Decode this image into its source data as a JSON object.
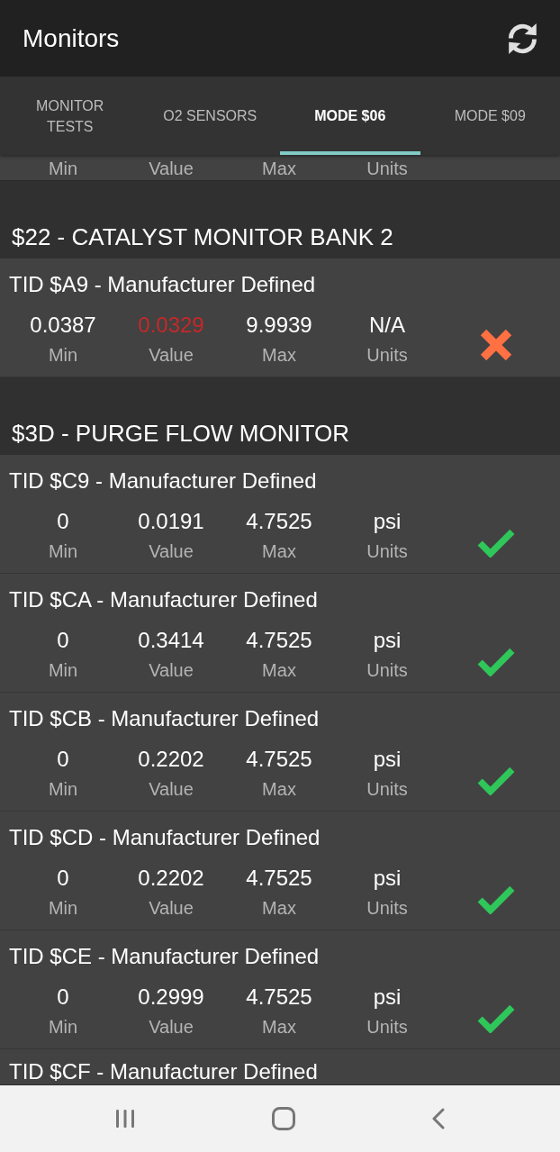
{
  "app_bar": {
    "title": "Monitors"
  },
  "tabs": [
    {
      "label": "MONITOR TESTS",
      "selected": false
    },
    {
      "label": "O2 SENSORS",
      "selected": false
    },
    {
      "label": "MODE $06",
      "selected": true
    },
    {
      "label": "MODE $09",
      "selected": false
    }
  ],
  "scrolled_row": {
    "labels": [
      "Min",
      "Value",
      "Max",
      "Units"
    ]
  },
  "sections": [
    {
      "title": "$22 - CATALYST MONITOR BANK 2",
      "tests": [
        {
          "title": "TID $A9 - Manufacturer Defined",
          "passed": false,
          "fields": [
            {
              "text": "0.0387",
              "label": "Min",
              "flagged": false
            },
            {
              "text": "0.0329",
              "label": "Value",
              "flagged": true
            },
            {
              "text": "9.9939",
              "label": "Max",
              "flagged": false
            },
            {
              "text": "N/A",
              "label": "Units",
              "flagged": false
            }
          ]
        }
      ]
    },
    {
      "title": "$3D - PURGE FLOW MONITOR",
      "tests": [
        {
          "title": "TID $C9 - Manufacturer Defined",
          "passed": true,
          "fields": [
            {
              "text": "0",
              "label": "Min",
              "flagged": false
            },
            {
              "text": "0.0191",
              "label": "Value",
              "flagged": false
            },
            {
              "text": "4.7525",
              "label": "Max",
              "flagged": false
            },
            {
              "text": "psi",
              "label": "Units",
              "flagged": false
            }
          ]
        },
        {
          "title": "TID $CA - Manufacturer Defined",
          "passed": true,
          "fields": [
            {
              "text": "0",
              "label": "Min",
              "flagged": false
            },
            {
              "text": "0.3414",
              "label": "Value",
              "flagged": false
            },
            {
              "text": "4.7525",
              "label": "Max",
              "flagged": false
            },
            {
              "text": "psi",
              "label": "Units",
              "flagged": false
            }
          ]
        },
        {
          "title": "TID $CB - Manufacturer Defined",
          "passed": true,
          "fields": [
            {
              "text": "0",
              "label": "Min",
              "flagged": false
            },
            {
              "text": "0.2202",
              "label": "Value",
              "flagged": false
            },
            {
              "text": "4.7525",
              "label": "Max",
              "flagged": false
            },
            {
              "text": "psi",
              "label": "Units",
              "flagged": false
            }
          ]
        },
        {
          "title": "TID $CD - Manufacturer Defined",
          "passed": true,
          "fields": [
            {
              "text": "0",
              "label": "Min",
              "flagged": false
            },
            {
              "text": "0.2202",
              "label": "Value",
              "flagged": false
            },
            {
              "text": "4.7525",
              "label": "Max",
              "flagged": false
            },
            {
              "text": "psi",
              "label": "Units",
              "flagged": false
            }
          ]
        },
        {
          "title": "TID $CE - Manufacturer Defined",
          "passed": true,
          "fields": [
            {
              "text": "0",
              "label": "Min",
              "flagged": false
            },
            {
              "text": "0.2999",
              "label": "Value",
              "flagged": false
            },
            {
              "text": "4.7525",
              "label": "Max",
              "flagged": false
            },
            {
              "text": "psi",
              "label": "Units",
              "flagged": false
            }
          ]
        },
        {
          "title": "TID $CF - Manufacturer Defined"
        }
      ]
    }
  ]
}
